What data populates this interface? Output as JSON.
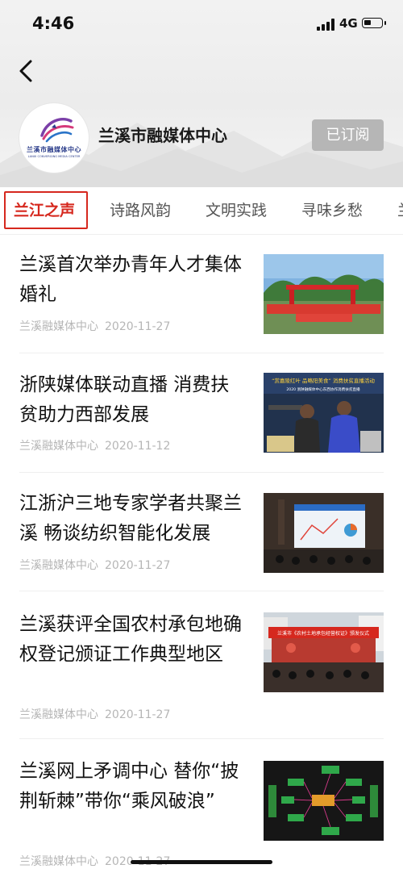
{
  "status_bar": {
    "time": "4:46",
    "network": "4G"
  },
  "header": {
    "channel_name": "兰溪市融媒体中心",
    "logo_text": "兰溪市融媒体中心",
    "logo_subtext": "LANXI CONVERGING MEDIA CENTER",
    "subscribe_label": "已订阅"
  },
  "tabs": [
    {
      "label": "兰江之声",
      "active": true
    },
    {
      "label": "诗路风韵",
      "active": false
    },
    {
      "label": "文明实践",
      "active": false
    },
    {
      "label": "寻味乡愁",
      "active": false
    },
    {
      "label": "兰",
      "active": false
    }
  ],
  "articles": [
    {
      "title": "兰溪首次举办青年人才集体婚礼",
      "source": "兰溪融媒体中心",
      "date": "2020-11-27"
    },
    {
      "title": "浙陕媒体联动直播 消费扶贫助力西部发展",
      "source": "兰溪融媒体中心",
      "date": "2020-11-12"
    },
    {
      "title": "江浙沪三地专家学者共聚兰溪 畅谈纺织智能化发展",
      "source": "兰溪融媒体中心",
      "date": "2020-11-27"
    },
    {
      "title": "兰溪获评全国农村承包地确权登记颁证工作典型地区",
      "source": "兰溪融媒体中心",
      "date": "2020-11-27"
    },
    {
      "title": "兰溪网上矛调中心 替你“披荆斩棘”带你“乘风破浪”",
      "source": "兰溪融媒体中心",
      "date": "2020-11-27"
    }
  ],
  "thumb_texts": {
    "live_banner": "“赏嘉陵红叶 品略阳美食” 消费扶贫直播活动",
    "live_sub": "2020 浙陕融媒体中心东西协作消费扶贫直播",
    "stage_banner": "兰溪市《农村土地承包经营权证》颁发仪式"
  },
  "colors": {
    "accent": "#d6281e",
    "subscribe_bg": "#b6b6b6",
    "meta": "#b6b6b6"
  }
}
